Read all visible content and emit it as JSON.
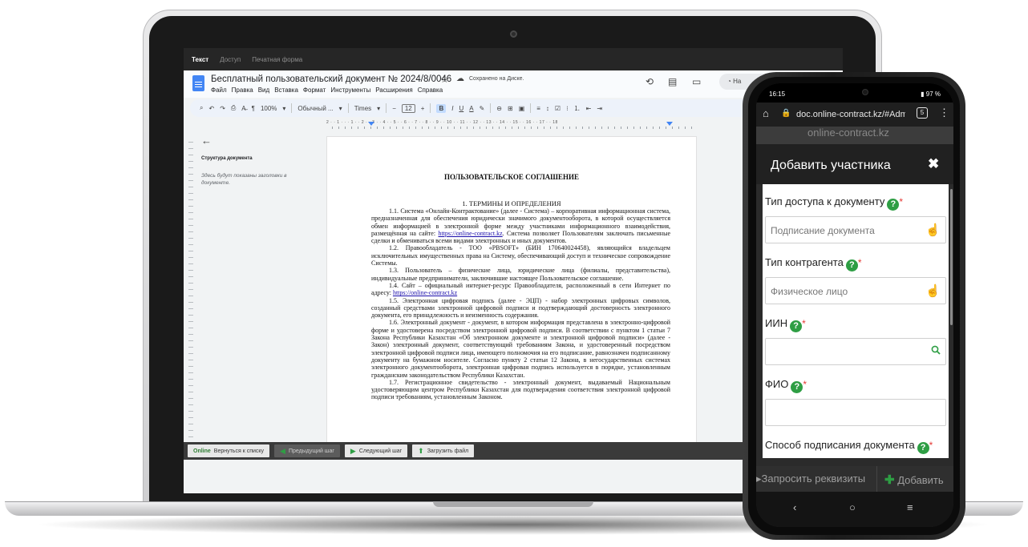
{
  "laptop": {
    "tabs": [
      "Текст",
      "Доступ",
      "Печатная форма"
    ],
    "doc": {
      "title": "Бесплатный пользовательский документ № 2024/8/0046",
      "saved_status": "Сохранено на Диске.",
      "menu": [
        "Файл",
        "Правка",
        "Вид",
        "Вставка",
        "Формат",
        "Инструменты",
        "Расширения",
        "Справка"
      ],
      "share_label": "На"
    },
    "toolbar": {
      "zoom": "100%",
      "style": "Обычный ...",
      "font": "Times",
      "size": "12",
      "bold": "B",
      "italic": "I",
      "underline": "U",
      "text_color": "A"
    },
    "ruler_text": "2 · · 1 · · · 1 · · 2 · · 3 · · 4 · · 5 · · 6 · · 7 · · 8 · · 9 · · 10 · · 11 · · 12 · · 13 · · 14 · · 15 · · 16 · · 17 · · 18",
    "outline": {
      "back_icon": "arrow-left-icon",
      "title": "Структура документа",
      "hint": "Здесь будут показаны заголовки в документе."
    },
    "page": {
      "title": "ПОЛЬЗОВАТЕЛЬСКОЕ СОГЛАШЕНИЕ",
      "section": "1. ТЕРМИНЫ И ОПРЕДЕЛЕНИЯ",
      "p1a": "1.1. Система «Онлайн-Контрактование» (далее - Система) – корпоративная информационная система, предназначенная для обеспечения юридически значимого документооборота, в которой осуществляется обмен информацией в электронной форме между участниками информационного взаимодействия, размещённая на сайте:",
      "p1_link": "https://online-contract.kz",
      "p1b": ". Система позволяет Пользователям заключать письменные сделки и обмениваться всеми видами электронных и иных документов.",
      "p2": "1.2. Правообладатель - ТОО «PBSOFT» (БИН 170640024458), являющийся владельцем исключительных имущественных права на Систему, обеспечивающий доступ и техническое сопровождение Системы.",
      "p3": "1.3. Пользователь – физические лица, юридические лица (филиалы, представительства), индивидуальные предприниматели, заключившие настоящее Пользовательское соглашение.",
      "p4": "1.4. Сайт – официальный интернет-ресурс Правообладателя, расположенный в сети Интернет по адресу:",
      "p4_link": "https://online-contract.kz",
      "p5": "1.5. Электронная цифровая подпись (далее - ЭЦП) - набор электронных цифровых символов, созданный средствами электронной цифровой подписи и подтверждающий достоверность электронного документа, его принадлежность и неизменность содержания.",
      "p6": "1.6. Электронный документ - документ, в котором информация представлена в электронно-цифровой форме и удостоверена посредством электронной цифровой подписи. В соответствии с пунктом 1 статьи 7 Закона Республики Казахстан «Об электронном документе и электронной цифровой подписи» (далее - Закон) электронный документ, соответствующий требованиям Закона, и удостоверенный посредством электронной цифровой подписи лица, имеющего полномочия на его подписание, равнозначен подписанному документу на бумажном носителе. Согласно пункту 2 статьи 12 Закона, в негосударственных системах электронного документооборота, электронная цифровая подпись используется в порядке, установленным гражданским законодательством Республики Казахстан.",
      "p7": "1.7. Регистрационное свидетельство - электронный документ, выдаваемый Национальным удостоверяющим центром Республики Казахстан для подтверждения соответствия электронной цифровой подписи требованиям, установленным Законом."
    },
    "bottom_buttons": {
      "logo": "Online",
      "back": "Вернуться к списку",
      "prev": "Предыдущий шаг",
      "next": "Следующий шаг",
      "upload": "Загрузить файл"
    }
  },
  "phone": {
    "status": {
      "time": "16:15",
      "battery": "97 %"
    },
    "browser": {
      "url": "doc.online-contract.kz/#Adm",
      "tab_count": "5"
    },
    "behind_header": "online-contract.kz",
    "modal": {
      "title": "Добавить участника",
      "fields": [
        {
          "label": "Тип доступа к документу",
          "value": "Подписание документа",
          "icon": "hand-pointer-icon"
        },
        {
          "label": "Тип контрагента",
          "value": "Физическое лицо",
          "icon": "hand-pointer-icon"
        },
        {
          "label": "ИИН",
          "value": "",
          "icon": "search-icon"
        },
        {
          "label": "ФИО",
          "value": "",
          "icon": ""
        },
        {
          "label": "Способ подписания документа",
          "value": "",
          "icon": ""
        }
      ],
      "required_mark": "*",
      "help_glyph": "?"
    },
    "footer": {
      "request": "Запросить реквизиты",
      "add": "Добавить"
    }
  },
  "colors": {
    "accent_green": "#2e9e44",
    "required_red": "#e53935",
    "docs_blue": "#4285f4"
  }
}
